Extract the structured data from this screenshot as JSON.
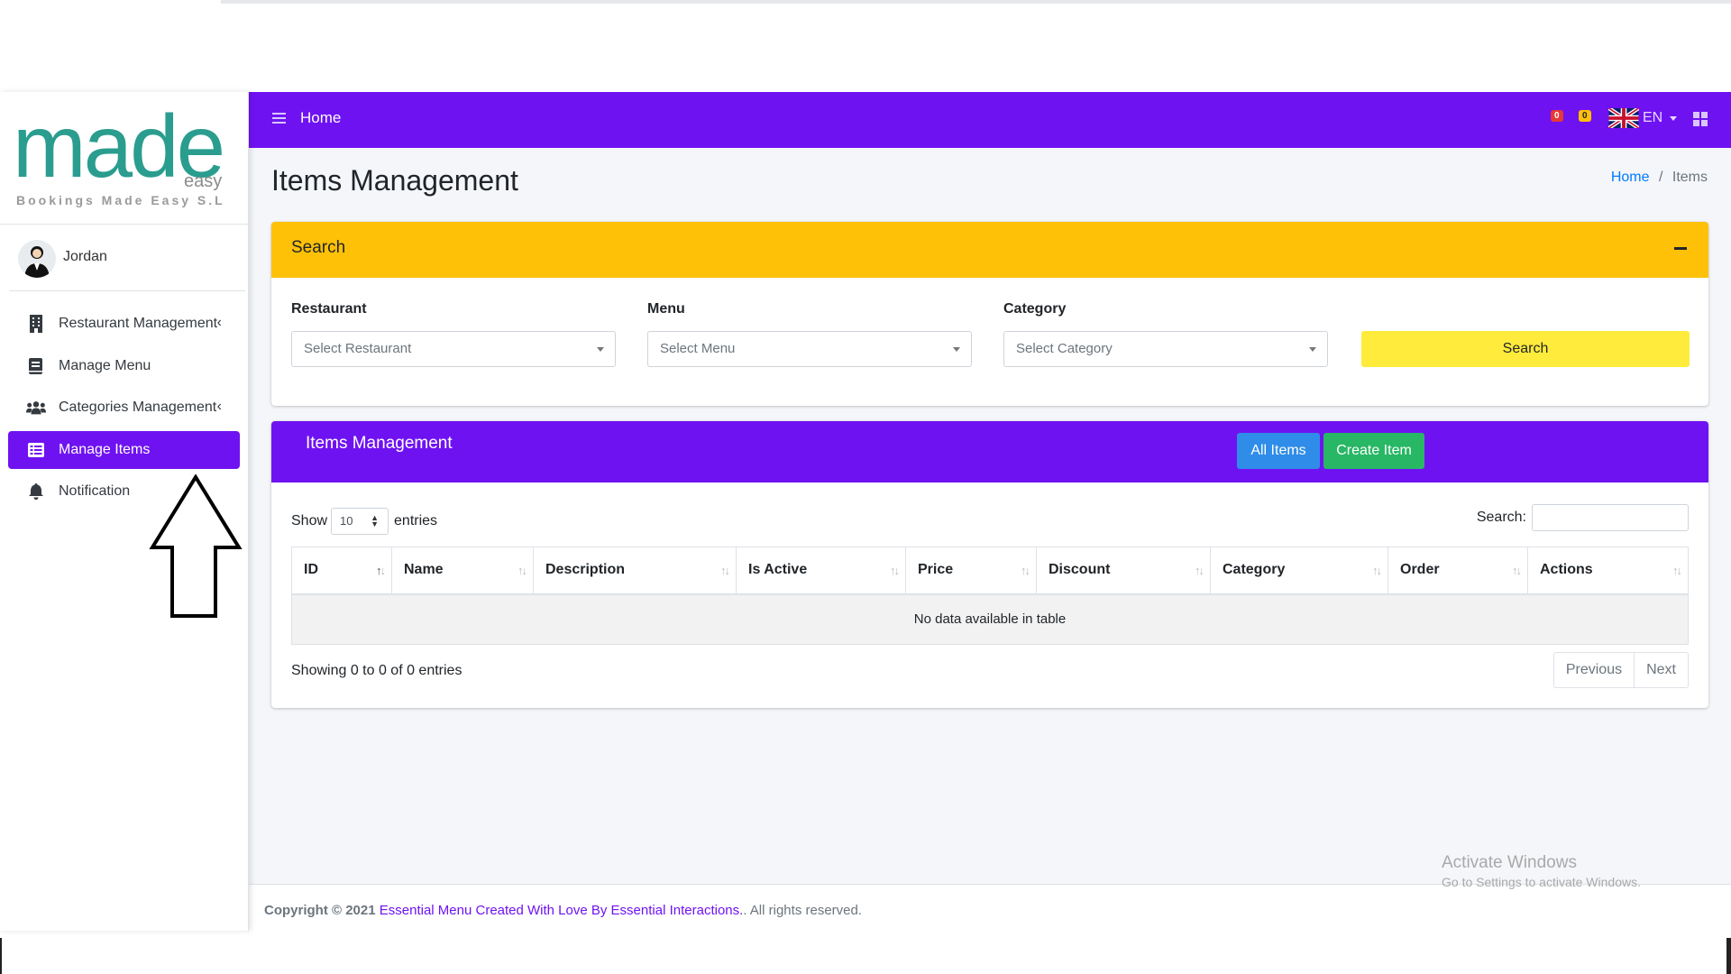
{
  "brand": {
    "logo": "made",
    "sub": "easy",
    "tagline": "Bookings Made Easy S.L"
  },
  "user": {
    "name": "Jordan"
  },
  "sidebar": {
    "items": [
      {
        "label": "Restaurant Management",
        "icon": "building-icon",
        "has_arrow": true
      },
      {
        "label": "Manage Menu",
        "icon": "book-icon",
        "has_arrow": false
      },
      {
        "label": "Categories Management",
        "icon": "users-icon",
        "has_arrow": true
      },
      {
        "label": "Manage Items",
        "icon": "list-icon",
        "active": true
      },
      {
        "label": "Notification",
        "icon": "bell-icon",
        "has_arrow": false
      }
    ],
    "arrow_glyph": "‹"
  },
  "navbar": {
    "home_label": "Home",
    "badge_messages": "0",
    "badge_notifications": "0",
    "language": "EN"
  },
  "page": {
    "title": "Items Management",
    "breadcrumb": {
      "home": "Home",
      "separator": "/",
      "current": "Items"
    }
  },
  "search_panel": {
    "title": "Search",
    "fields": [
      {
        "label": "Restaurant",
        "placeholder": "Select Restaurant"
      },
      {
        "label": "Menu",
        "placeholder": "Select Menu"
      },
      {
        "label": "Category",
        "placeholder": "Select Category"
      }
    ],
    "button_label": "Search"
  },
  "items_panel": {
    "title": "Items Management",
    "btn_all": "All Items",
    "btn_create": "Create Item",
    "show_label": "Show",
    "entries_label": "entries",
    "page_length": "10",
    "search_label": "Search:",
    "columns": [
      "ID",
      "Name",
      "Description",
      "Is Active",
      "Price",
      "Discount",
      "Category",
      "Order",
      "Actions"
    ],
    "empty_message": "No data available in table",
    "info": "Showing 0 to 0 of 0 entries",
    "prev_label": "Previous",
    "next_label": "Next"
  },
  "footer": {
    "copyright": "Copyright © 2021",
    "link_text": "Essential Menu Created With Love By Essential Interactions.",
    "rights": ". All rights reserved."
  },
  "watermark": {
    "line1": "Activate Windows",
    "line2": "Go to Settings to activate Windows."
  },
  "colors": {
    "primary": "#6f12f2",
    "warning": "#ffc107",
    "search_button": "#ffeb3b",
    "info_button": "#2f8ce8",
    "success_button": "#28b765",
    "logo": "#2a9d8f"
  }
}
